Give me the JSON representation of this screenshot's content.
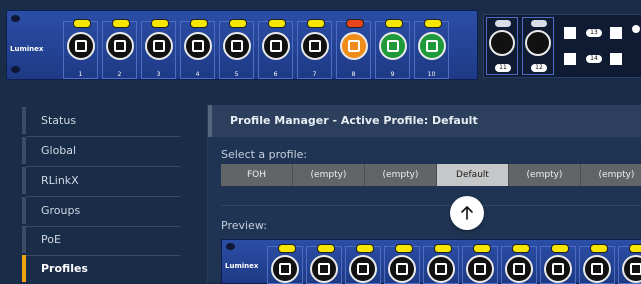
{
  "device": {
    "brand": "Luminex",
    "ports": [
      {
        "num": "1",
        "led": "#f7e600",
        "jack": "black"
      },
      {
        "num": "2",
        "led": "#f7e600",
        "jack": "black"
      },
      {
        "num": "3",
        "led": "#f7e600",
        "jack": "black"
      },
      {
        "num": "4",
        "led": "#f7e600",
        "jack": "black"
      },
      {
        "num": "5",
        "led": "#f7e600",
        "jack": "black"
      },
      {
        "num": "6",
        "led": "#f7e600",
        "jack": "black"
      },
      {
        "num": "7",
        "led": "#f7e600",
        "jack": "black"
      },
      {
        "num": "8",
        "led": "#e8451c",
        "jack": "orange"
      },
      {
        "num": "9",
        "led": "#f7e600",
        "jack": "green"
      },
      {
        "num": "10",
        "led": "#f7e600",
        "jack": "green"
      }
    ],
    "sfp_ports": [
      {
        "num": "11"
      },
      {
        "num": "12"
      }
    ],
    "extra_ports": [
      "13",
      "14"
    ]
  },
  "sidebar": {
    "items": [
      {
        "label": "Status"
      },
      {
        "label": "Global"
      },
      {
        "label": "RLinkX"
      },
      {
        "label": "Groups"
      },
      {
        "label": "PoE"
      },
      {
        "label": "Profiles"
      }
    ],
    "active": "Profiles"
  },
  "main": {
    "title": "Profile Manager - Active Profile: Default",
    "select_label": "Select a profile:",
    "profiles": [
      "FOH",
      "(empty)",
      "(empty)",
      "Default",
      "(empty)",
      "(empty)"
    ],
    "selected_profile": "Default",
    "preview_label": "Preview:",
    "preview_brand": "Luminex"
  },
  "scroll_button": {
    "icon": "arrow-up-icon"
  },
  "colors": {
    "background": "#1a2d48",
    "accent": "#f2a20d",
    "panel_blue": "#2b4ea6",
    "led_yellow": "#f7e600"
  }
}
